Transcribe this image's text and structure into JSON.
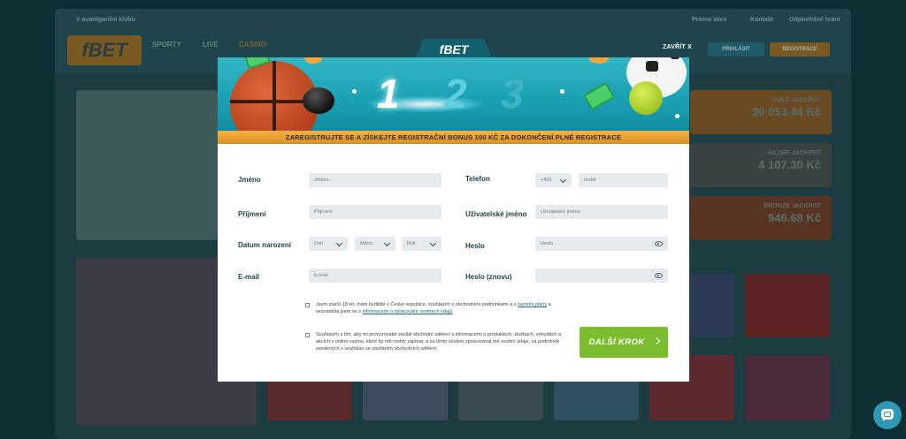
{
  "background": {
    "top_link": "V avantgardní klubu",
    "top_right_links": [
      "Promo akce",
      "Kontakt",
      "Odpovědné hraní"
    ],
    "nav": [
      "SPORTY",
      "LIVE",
      "CASINO"
    ],
    "login_label": "PŘIHLÁSIT",
    "register_label": "REGISTRACE",
    "jackpots": [
      {
        "title": "GOLD JACKPOT",
        "value": "30 053.44 Kč"
      },
      {
        "title": "SILVER JACKPOT",
        "value": "4 107.30 Kč"
      },
      {
        "title": "BRONZE JACKPOT",
        "value": "946.68 Kč"
      }
    ]
  },
  "modal": {
    "tab_logo": "fBET",
    "close_label": "ZAVŘÍT X",
    "steps": [
      "1",
      "2",
      "3"
    ],
    "banner_text": "ZAREGISTRUJTE SE A ZÍSKEJTE REGISTRAČNÍ BONUS 100 KČ ZA DOKONČENÍ PLNÉ REGISTRACE",
    "fields": {
      "first_name": {
        "label": "Jméno",
        "placeholder": "Jméno"
      },
      "last_name": {
        "label": "Příjmení",
        "placeholder": "Příjmení"
      },
      "birth_date": {
        "label": "Datum narození",
        "day": "Den",
        "month": "Měsíc",
        "year": "Rok"
      },
      "email": {
        "label": "E-mail",
        "placeholder": "E-mail"
      },
      "phone": {
        "label": "Telefon",
        "prefix": "+420",
        "placeholder": "mobil"
      },
      "username": {
        "label": "Uživatelské jméno",
        "placeholder": "Uživatelské jméno"
      },
      "password": {
        "label": "Heslo",
        "placeholder": "Heslo"
      },
      "password_repeat": {
        "label": "Heslo (znovu)",
        "placeholder": ""
      }
    },
    "consent_1": {
      "text_a": "Jsem starší 18 let, mám bydliště v České republice, souhlasím s obchodními podmínkami a s ",
      "link_a": "herními plány",
      "text_b": " a seznámil/a jsem se s ",
      "link_b": "informacemi o zpracování osobních údajů",
      "text_c": "."
    },
    "consent_2": "Souhlasím s tím, aby mi provozovatel zasílal obchodní sdělení s informacemi o produktech, službách, výhodách a akcích v online casinu, které by mě mohly zajímat, a za tímto účelem zpracovával mé osobní údaje, za podmínek uvedených v souhlasu se zasíláním obchodních sdělení.",
    "next_label": "DALŠÍ KROK"
  }
}
